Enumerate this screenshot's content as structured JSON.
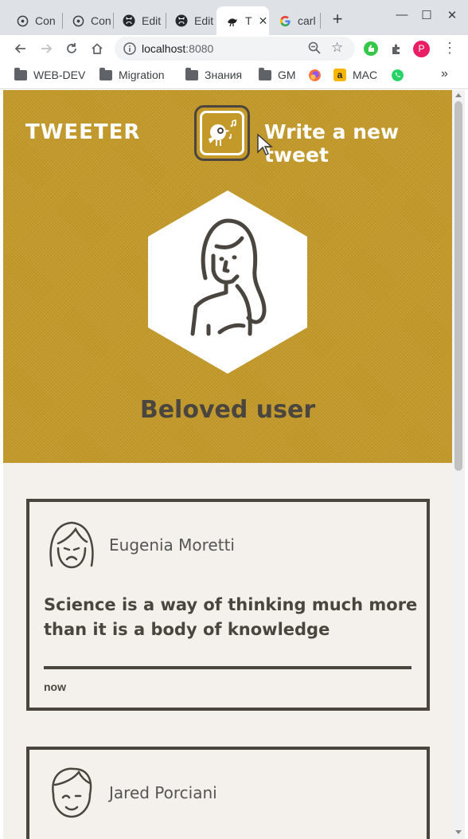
{
  "browser": {
    "tabs": [
      {
        "title": "Con",
        "icon": "globe-icon"
      },
      {
        "title": "Con",
        "icon": "globe-icon"
      },
      {
        "title": "Edit",
        "icon": "github-icon"
      },
      {
        "title": "Edit",
        "icon": "github-icon"
      },
      {
        "title": "T",
        "icon": "bird-icon",
        "active": true
      },
      {
        "title": "carl",
        "icon": "google-icon"
      }
    ],
    "new_tab": "+",
    "url_host": "localhost",
    "url_port": ":8080",
    "profile_initial": "P",
    "bookmarks": [
      "WEB-DEV",
      "Migration",
      "Знания",
      "GM",
      "MAC"
    ],
    "bookmarks_more": "»"
  },
  "page": {
    "brand": "TWEETER",
    "compose_label": "Write a new tweet",
    "profile_name": "Beloved user",
    "tweets": [
      {
        "author": "Eugenia Moretti",
        "text": "Science is a way of thinking much more than it is a body of knowledge",
        "time": "now"
      },
      {
        "author": "Jared Porciani",
        "text": "",
        "time": ""
      }
    ]
  },
  "colors": {
    "hero": "#c39a2a",
    "ink": "#4a463f",
    "paper": "#f4f1ec"
  }
}
